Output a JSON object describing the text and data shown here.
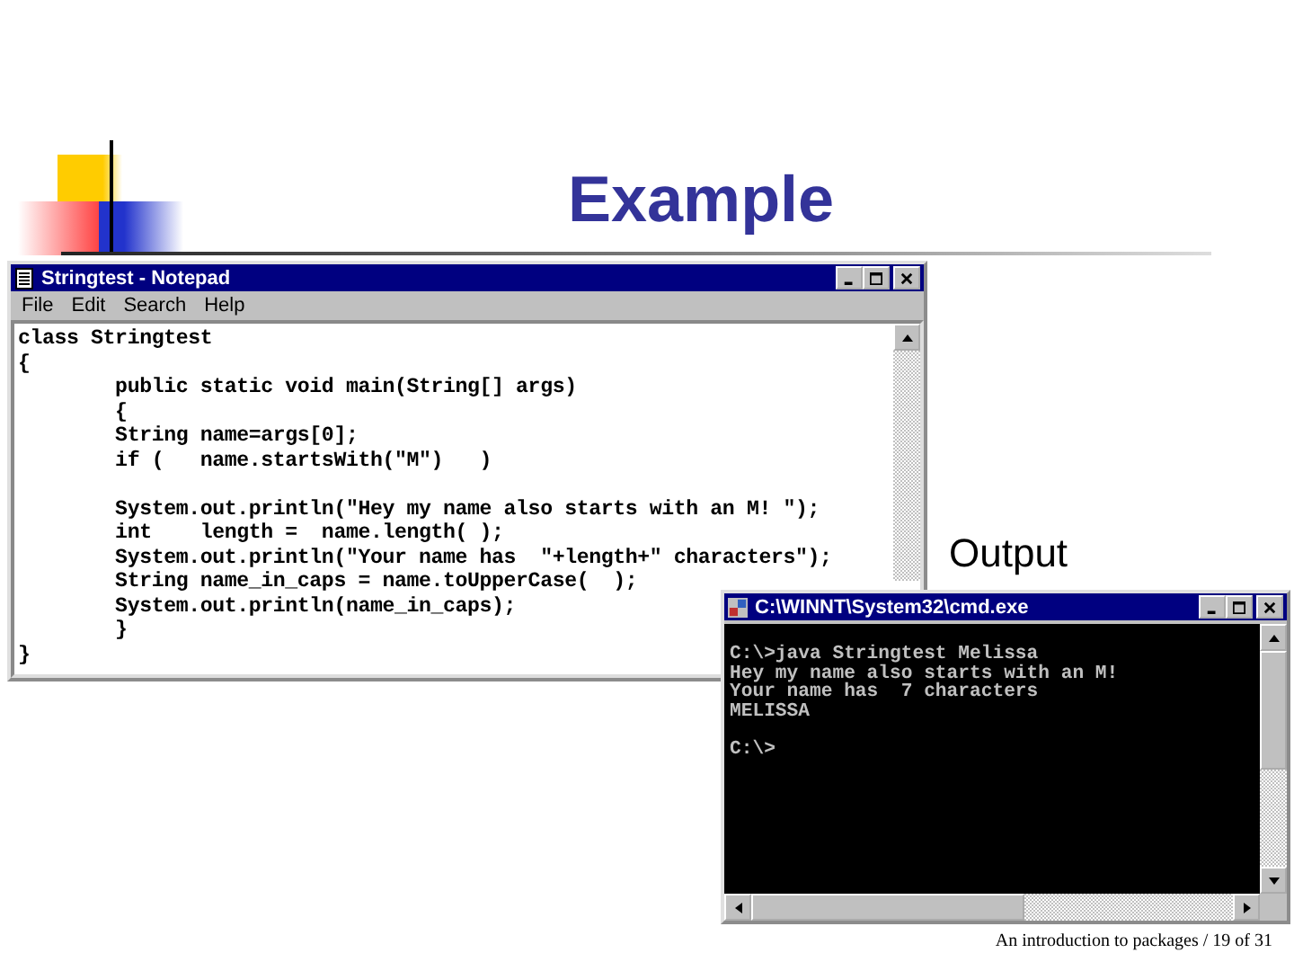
{
  "slide": {
    "title": "Example",
    "output_label": "Output",
    "footer": "An introduction to packages  / 19 of 31"
  },
  "notepad": {
    "title": "Stringtest - Notepad",
    "menu": [
      "File",
      "Edit",
      "Search",
      "Help"
    ],
    "blocks": [
      [
        "class Stringtest",
        "{",
        "        public static void main(String[] args)",
        "        {",
        "        String name=args[0];",
        "        if (   name.startsWith(\"M\")   )"
      ],
      [
        "        System.out.println(\"Hey my name also starts with an M! \");",
        "        int    length =  name.length( );",
        "        System.out.println(\"Your name has  \"+length+\" characters\");",
        "        String name_in_caps = name.toUpperCase(  );",
        "        System.out.println(name_in_caps);",
        "        }",
        "}"
      ]
    ]
  },
  "console": {
    "title": "C:\\WINNT\\System32\\cmd.exe",
    "blocks": [
      [
        "C:\\>java Stringtest Melissa",
        "Hey my name also starts with an M!",
        "Your name has  7 characters",
        "MELISSA"
      ],
      [
        "C:\\>"
      ]
    ]
  }
}
